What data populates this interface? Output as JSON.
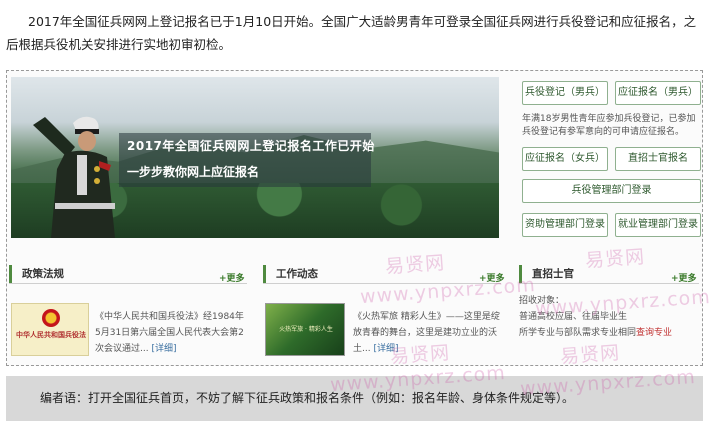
{
  "intro": {
    "text": "2017年全国征兵网网上登记报名已于1月10日开始。全国广大适龄男青年可登录全国征兵网进行兵役登记和应征报名，之后根据兵役机关安排进行实地初审初检。"
  },
  "banner": {
    "line1": "2017年全国征兵网网上登记报名工作已开始",
    "line2": "一步步教你网上应征报名"
  },
  "actions": {
    "registration_male": "兵役登记（男兵）",
    "enlist_male": "应征报名（男兵）",
    "note": "年满18岁男性青年应参加兵役登记，已参加兵役登记有参军意向的可申请应征报名。",
    "enlist_female": "应征报名（女兵）",
    "direct_recruit": "直招士官报名",
    "dept_login": "兵役管理部门登录",
    "aid_login": "资助管理部门登录",
    "employment_login": "就业管理部门登录"
  },
  "sections": {
    "policy": {
      "title": "政策法规",
      "more": "+更多",
      "thumb_text": "中华人民共和国兵役法",
      "line1": "《中华人民共和国兵役法》经1984年",
      "line2": "5月31日第六届全国人民代表大会第2",
      "line3_text": "次会议通过...",
      "detail": "[详细]"
    },
    "work": {
      "title": "工作动态",
      "more": "+更多",
      "thumb_text": "火热军旅 · 精彩人生",
      "line1": "《火热军旅 精彩人生》——这里是绽",
      "line2": "放青春的舞台，这里是建功立业的沃",
      "line3_text": "土...",
      "detail": "[详细]"
    },
    "recruit": {
      "title": "直招士官",
      "more": "+更多",
      "line1": "招收对象：",
      "line2": "普通高校应届、往届毕业生",
      "line3_text": "所学专业与部队需求专业相同",
      "query": "查询专业"
    }
  },
  "editor_note": "编者语：打开全国征兵首页，不妨了解下征兵政策和报名条件（例如：报名年龄、身体条件规定等）。",
  "watermarks": {
    "cn": "易贤网",
    "url": "www.ynpxrz.com"
  },
  "colors": {
    "accent_green": "#4f8a3f",
    "button_border": "#8fb08f",
    "link_blue": "#3a6fa0",
    "query_red": "#c03030",
    "editor_bg": "#d8d8d8"
  }
}
